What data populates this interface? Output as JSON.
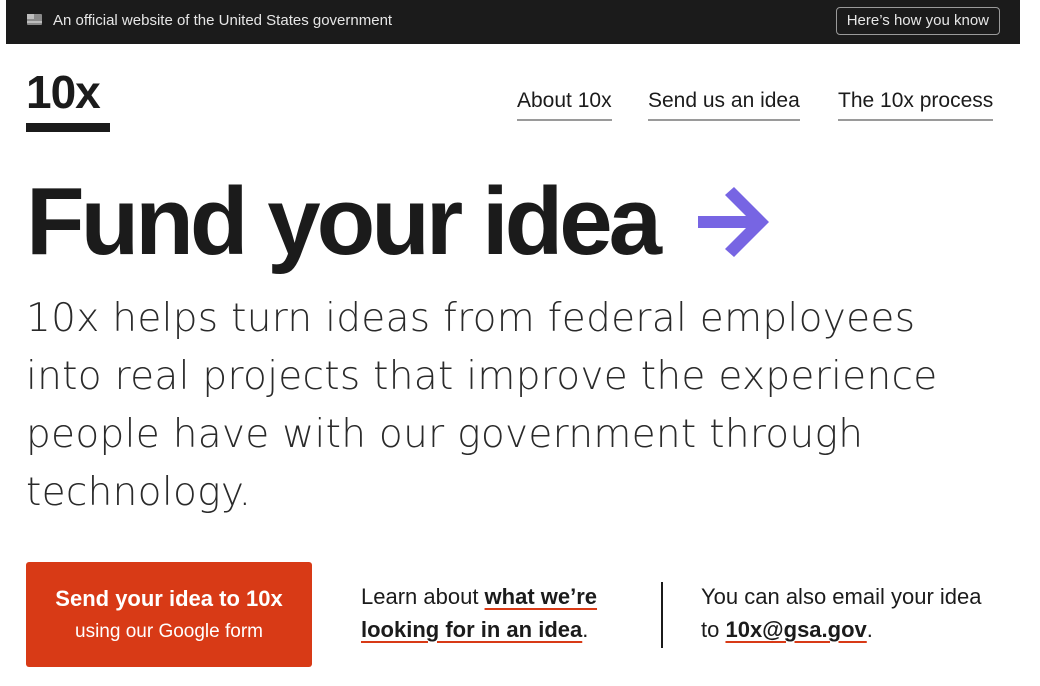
{
  "gov_banner": {
    "flag_icon": "us-flag-icon",
    "text": "An official website of the United States government",
    "button_label": "Here’s how you know"
  },
  "header": {
    "logo": "10x",
    "nav": [
      "About 10x",
      "Send us an idea",
      "The 10x process"
    ]
  },
  "hero": {
    "title": "Fund your idea",
    "arrow_icon": "arrow-right-icon",
    "description": "10x helps turn ideas from federal employees into real projects that improve the experience people have with our government through technology."
  },
  "cta": {
    "button_line1": "Send your idea to 10x",
    "button_line2": "using our Google form",
    "learn_prefix": "Learn about ",
    "learn_link": "what we’re looking for in an idea",
    "learn_suffix": ".",
    "email_prefix": "You can also email your idea to ",
    "email_link": "10x@gsa.gov",
    "email_suffix": "."
  },
  "colors": {
    "banner_bg": "#1b1b1b",
    "accent_arrow": "#7765e3",
    "cta_red": "#d83a16",
    "text": "#1b1b1b"
  }
}
